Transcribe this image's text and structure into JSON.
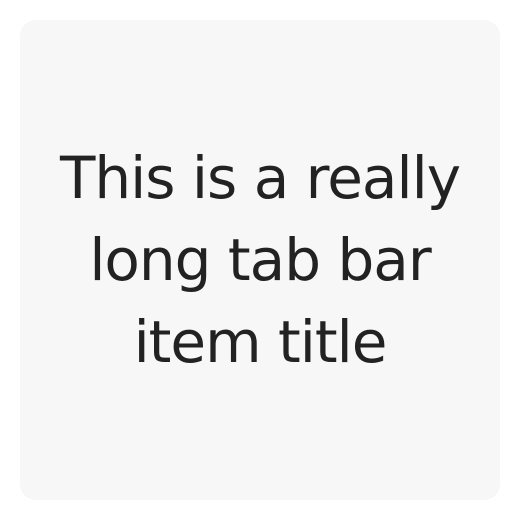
{
  "tab_bar_item": {
    "title": "This is a really long tab bar item title"
  },
  "colors": {
    "background": "#ffffff",
    "item_background": "#f7f7f7",
    "text": "#222222"
  }
}
